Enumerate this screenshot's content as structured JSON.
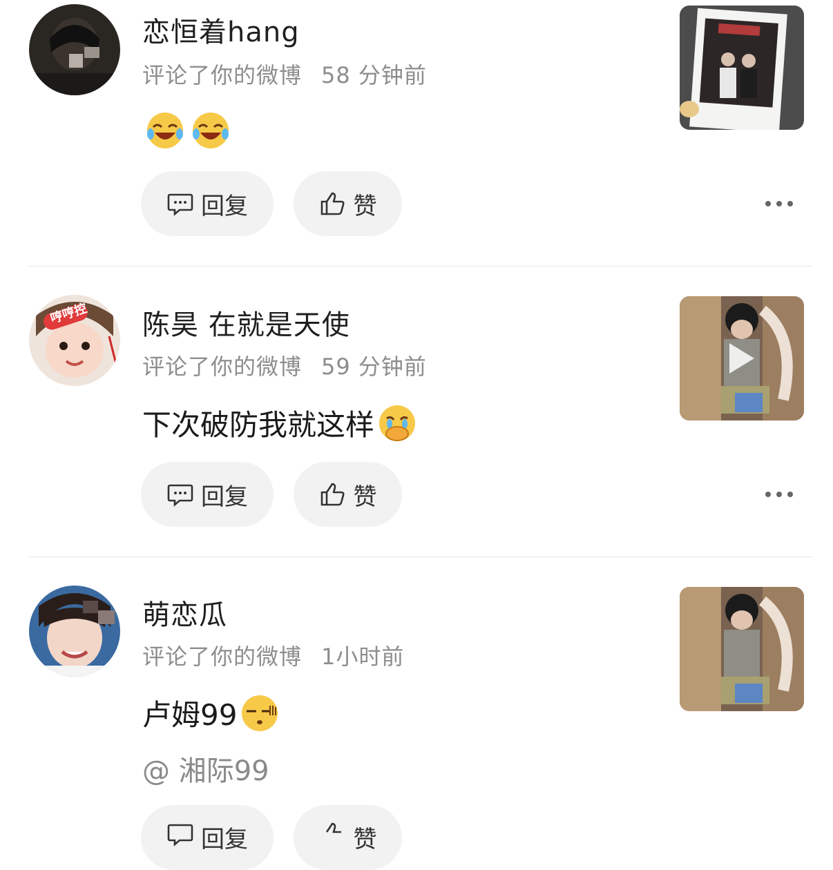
{
  "actions": {
    "reply_label": "回复",
    "like_label": "赞"
  },
  "notifications": [
    {
      "username": "恋恒着hang",
      "action_text": "评论了你的微博",
      "time": "58 分钟前",
      "content": "",
      "emojis": [
        "laugh-cry-emoji",
        "laugh-cry-emoji"
      ],
      "thumbnail": "photo-thumbnail"
    },
    {
      "username": "陈昊 在就是天使",
      "avatar_badge": "哼哼控",
      "action_text": "评论了你的微博",
      "time": "59 分钟前",
      "content": "下次破防我就这样",
      "emojis": [
        "cover-mouth-cry-emoji"
      ],
      "thumbnail": "video-thumbnail"
    },
    {
      "username": "萌恋瓜",
      "action_text": "评论了你的微博",
      "time": "1小时前",
      "content": "卢姆99",
      "emojis": [
        "dizzy-face-emoji"
      ],
      "quote": "@ 湘际99",
      "thumbnail": "photo-thumbnail"
    }
  ]
}
